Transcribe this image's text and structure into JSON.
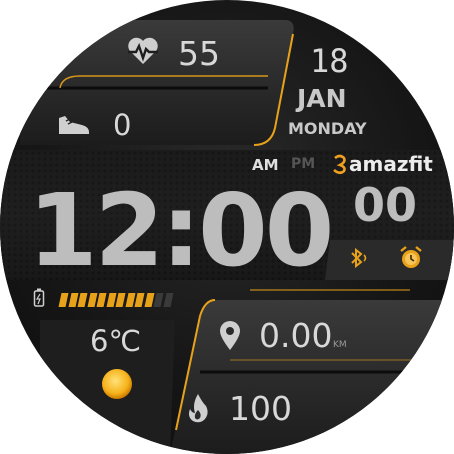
{
  "heart_rate": {
    "icon": "heart-pulse-icon",
    "value": "55"
  },
  "steps": {
    "icon": "sneaker-icon",
    "value": "0"
  },
  "date": {
    "day": "18",
    "month": "JAN",
    "weekday": "MONDAY"
  },
  "time": {
    "hours_minutes": "12:00",
    "seconds": "00",
    "am": "AM",
    "pm": "PM",
    "active_period": "AM"
  },
  "brand": "amazfit",
  "status_icons": {
    "bluetooth": "bluetooth-icon",
    "alarm": "alarm-icon"
  },
  "battery": {
    "icon": "battery-icon",
    "level_fraction": 0.83
  },
  "weather": {
    "temperature": "6℃",
    "icon": "sun-icon"
  },
  "distance": {
    "icon": "location-pin-icon",
    "value": "0.00",
    "unit": "KM"
  },
  "calories": {
    "icon": "flame-icon",
    "value": "100"
  },
  "colors": {
    "accent": "#e8a21a",
    "text": "#d8d8d8",
    "background": "#161616"
  }
}
